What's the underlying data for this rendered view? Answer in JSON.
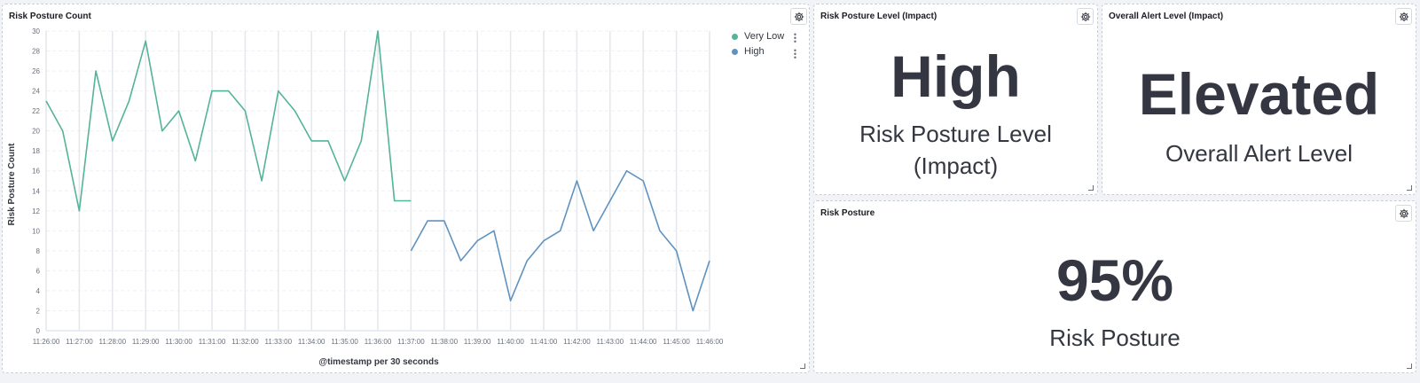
{
  "chart_panel": {
    "title": "Risk Posture Count"
  },
  "chart_data": {
    "type": "line",
    "title": "",
    "xlabel": "@timestamp per 30 seconds",
    "ylabel": "Risk Posture Count",
    "ylim": [
      0,
      30
    ],
    "yticks": [
      "0",
      "2",
      "4",
      "6",
      "8",
      "10",
      "12",
      "14",
      "16",
      "18",
      "20",
      "22",
      "24",
      "26",
      "28",
      "30"
    ],
    "xticks": [
      "11:26:00",
      "11:27:00",
      "11:28:00",
      "11:29:00",
      "11:30:00",
      "11:31:00",
      "11:32:00",
      "11:33:00",
      "11:34:00",
      "11:35:00",
      "11:36:00",
      "11:37:00",
      "11:38:00",
      "11:39:00",
      "11:40:00",
      "11:41:00",
      "11:42:00",
      "11:43:00",
      "11:44:00",
      "11:45:00",
      "11:46:00"
    ],
    "grid": true,
    "legend": "top-right",
    "series": [
      {
        "name": "Very Low",
        "color": "#54b399",
        "x_start": "11:26:00",
        "interval": "30s",
        "values": [
          23,
          20,
          12,
          26,
          19,
          23,
          29,
          20,
          22,
          17,
          24,
          24,
          22,
          15,
          24,
          22,
          19,
          19,
          15,
          19,
          30,
          13,
          13
        ]
      },
      {
        "name": "High",
        "color": "#6092c0",
        "x_start": "11:37:00",
        "interval": "30s",
        "values": [
          8,
          11,
          11,
          7,
          9,
          10,
          3,
          7,
          9,
          10,
          15,
          10,
          13,
          16,
          15,
          10,
          8,
          2,
          7
        ]
      }
    ]
  },
  "risk_level_panel": {
    "title": "Risk Posture Level (Impact)",
    "value": "High",
    "label_line1": "Risk Posture Level",
    "label_line2": "(Impact)"
  },
  "alert_panel": {
    "title": "Overall Alert Level (Impact)",
    "value": "Elevated",
    "label": "Overall Alert Level"
  },
  "posture_panel": {
    "title": "Risk Posture",
    "value": "95%",
    "label": "Risk Posture"
  },
  "icons": {
    "panel_options": "gear-icon",
    "legend_options": "vertical-dots-icon",
    "resize": "resize-handle-icon"
  }
}
